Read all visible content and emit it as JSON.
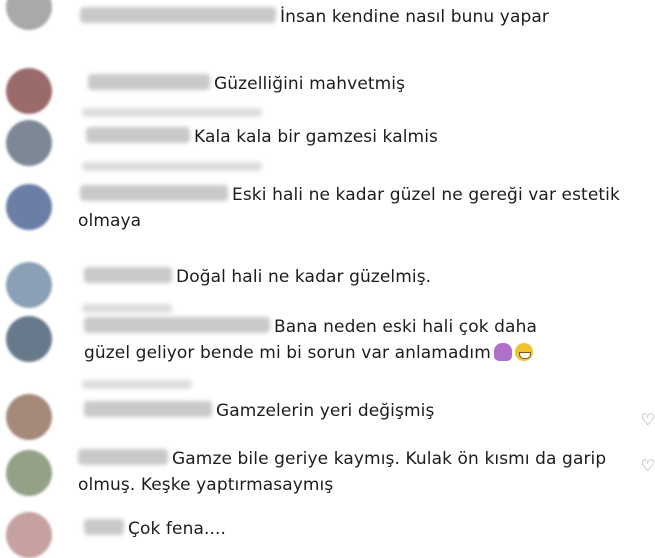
{
  "comments": [
    {
      "text": "İnsan kendine nasıl bunu yapar"
    },
    {
      "text": "Güzelliğini mahvetmiş"
    },
    {
      "text": "Kala kala bir gamzesi kalmis"
    },
    {
      "text": "Eski hali ne kadar güzel ne gereği var estetik olmaya"
    },
    {
      "text": "Doğal hali ne kadar güzelmiş."
    },
    {
      "text": "Bana neden eski hali çok daha güzel geliyor bende mi bi sorun var anlamadım"
    },
    {
      "text": "Gamzelerin yeri değişmiş"
    },
    {
      "text": "Gamze bile geriye kaymış. Kulak ön kısmı da garip olmuş. Keşke yaptırmasaymış"
    },
    {
      "text": "Çok fena...."
    }
  ],
  "icons": {
    "like": "heart-outline-icon",
    "emoji_1": "person-gesturing-emoji",
    "emoji_2": "grinning-face-emoji"
  },
  "colors": {
    "text": "#1c1c1c",
    "background": "#ffffff",
    "icon": "#8a8a8a"
  }
}
